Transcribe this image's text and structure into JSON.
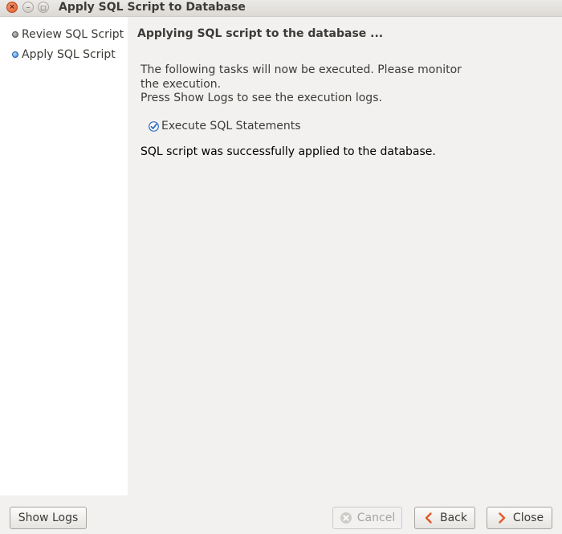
{
  "window": {
    "title": "Apply SQL Script to Database"
  },
  "sidebar": {
    "steps": [
      {
        "label": "Review SQL Script",
        "state": "done"
      },
      {
        "label": "Apply SQL Script",
        "state": "current"
      }
    ]
  },
  "main": {
    "title": "Applying SQL script to the database ...",
    "description": [
      "The following tasks will now be executed. Please monitor",
      "the execution.",
      "Press Show Logs to see the execution logs."
    ],
    "tasks": [
      {
        "label": "Execute SQL Statements",
        "checked": true
      }
    ],
    "status": "SQL script was successfully applied to the database."
  },
  "buttons": {
    "show_logs": "Show Logs",
    "cancel": "Cancel",
    "back": "Back",
    "close": "Close"
  },
  "icons": {
    "window_close": "close-icon",
    "window_minimize": "minimize-icon",
    "window_maximize": "maximize-icon",
    "check": "checkmark-icon",
    "cancel": "cancel-icon",
    "back": "chevron-left-icon",
    "close": "chevron-right-icon"
  },
  "colors": {
    "accent": "#e2582a",
    "sidebar_bg": "#ffffff",
    "window_bg": "#f2f1f0",
    "text": "#3c3b37",
    "check_blue": "#2f6cc4"
  }
}
